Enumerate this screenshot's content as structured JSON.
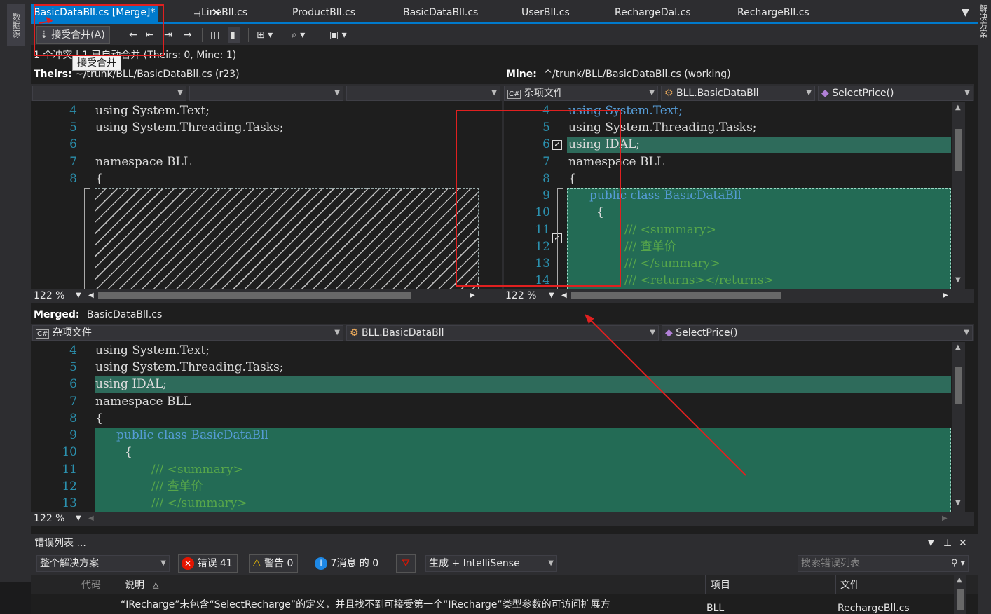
{
  "left_strip": {
    "label": "数据源"
  },
  "right_strip": {
    "label": "解决方案"
  },
  "tabs": [
    {
      "label": "BasicDataBll.cs [Merge]*"
    },
    {
      "label": "LineBll.cs"
    },
    {
      "label": "ProductBll.cs"
    },
    {
      "label": "BasicDataBll.cs"
    },
    {
      "label": "UserBll.cs"
    },
    {
      "label": "RechargeDal.cs"
    },
    {
      "label": "RechargeBll.cs"
    }
  ],
  "toolbar": {
    "accept_label": "接受合并(A)"
  },
  "conflict_line": "1 个冲突 | 1 已自动合并 (Theirs:  0, Mine:  1)",
  "tooltip": "接受合并",
  "theirs": {
    "label": "Theirs:",
    "path": "~/trunk/BLL/BasicDataBll.cs (r23)",
    "zoom": "122 %",
    "line_numbers": [
      "4",
      "5",
      "6",
      "7",
      "8"
    ],
    "lines": [
      "using System.Text;",
      "using System.Threading.Tasks;",
      "",
      "namespace BLL",
      "{"
    ]
  },
  "mine": {
    "label": "Mine:",
    "path": "^/trunk/BLL/BasicDataBll.cs (working)",
    "zoom": "122 %",
    "nav": {
      "project": "杂项文件",
      "class": "BLL.BasicDataBll",
      "member": "SelectPrice()"
    },
    "line_numbers": [
      "4",
      "5",
      "6",
      "7",
      "8",
      "9",
      "10",
      "11",
      "12",
      "13",
      "14"
    ],
    "lines": [
      "using System.Text;",
      "using System.Threading.Tasks;",
      "using IDAL;",
      "namespace BLL",
      "{",
      "public class BasicDataBll",
      "{",
      "/// <summary>",
      "/// 查单价",
      "/// </summary>",
      "/// <returns></returns>"
    ]
  },
  "merged": {
    "label": "Merged:",
    "file": "BasicDataBll.cs",
    "zoom": "122 %",
    "nav": {
      "project": "杂项文件",
      "class": "BLL.BasicDataBll",
      "member": "SelectPrice()"
    },
    "line_numbers": [
      "4",
      "5",
      "6",
      "7",
      "8",
      "9",
      "10",
      "11",
      "12",
      "13"
    ],
    "lines": [
      "using System.Text;",
      "using System.Threading.Tasks;",
      "using IDAL;",
      "namespace BLL",
      "{",
      "public class BasicDataBll",
      "{",
      "/// <summary>",
      "/// 查单价",
      "/// </summary>"
    ]
  },
  "error_list": {
    "title": "错误列表 ...",
    "scope": "整个解决方案",
    "errors": "错误 41",
    "warnings": "警告 0",
    "messages": "7消息 的 0",
    "build_filter": "生成 + IntelliSense",
    "search_placeholder": "搜索错误列表",
    "columns": {
      "code": "代码",
      "description": "说明",
      "project": "项目",
      "file": "文件"
    },
    "row": {
      "description": "“IRecharge”未包含“SelectRecharge”的定义，并且找不到可接受第一个“IRecharge”类型参数的可访问扩展方",
      "project": "BLL",
      "file": "RechargeBll.cs"
    }
  },
  "colors": {
    "accent": "#007acc",
    "highlight": "#236b55",
    "annotation": "#e02020"
  }
}
